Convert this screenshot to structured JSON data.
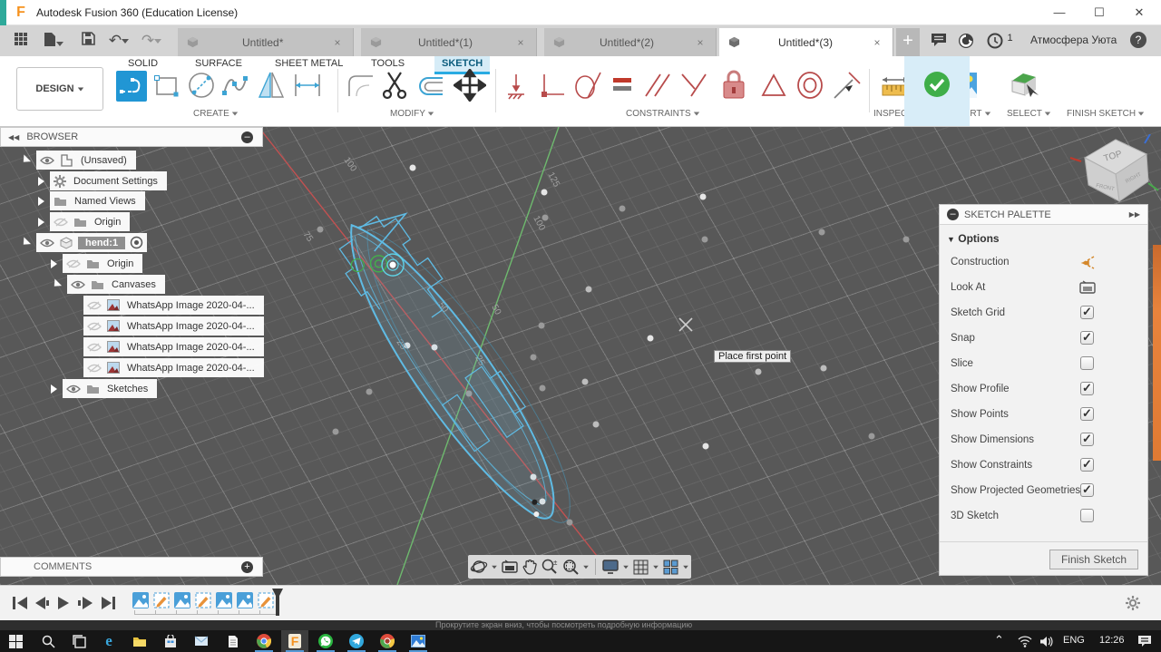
{
  "window": {
    "title": "Autodesk Fusion 360 (Education License)",
    "controls": {
      "minimize": "—",
      "maximize": "☐",
      "close": "✕"
    }
  },
  "icons": {
    "dropdown": "▼",
    "undo": "↶",
    "redo": "↷",
    "plus": "+",
    "help": "?",
    "collapse_left": "◀◀",
    "expand_right": "▶▶",
    "minus": "–",
    "chevron_up": "⌃",
    "options_arrow": "▼",
    "close": "×"
  },
  "quickbar": {
    "user": "Атмосфера Уюта",
    "notification_count": "1"
  },
  "tabs": {
    "items": [
      {
        "label": "Untitled*"
      },
      {
        "label": "Untitled*(1)"
      },
      {
        "label": "Untitled*(2)"
      },
      {
        "label": "Untitled*(3)"
      }
    ]
  },
  "ribbon": {
    "design": "DESIGN",
    "workspaces": [
      "SOLID",
      "SURFACE",
      "SHEET METAL",
      "TOOLS",
      "SKETCH"
    ],
    "active_workspace": "SKETCH",
    "groups": {
      "create": "CREATE",
      "modify": "MODIFY",
      "constraints": "CONSTRAINTS",
      "inspect": "INSPECT",
      "insert": "INSERT",
      "select": "SELECT",
      "finish": "FINISH SKETCH"
    }
  },
  "browser": {
    "title": "BROWSER",
    "items": [
      {
        "label": "(Unsaved)"
      },
      {
        "label": "Document Settings"
      },
      {
        "label": "Named Views"
      },
      {
        "label": "Origin"
      },
      {
        "label": "hend:1"
      },
      {
        "label": "Origin"
      },
      {
        "label": "Canvases"
      },
      {
        "label": "WhatsApp Image 2020-04-..."
      },
      {
        "label": "WhatsApp Image 2020-04-..."
      },
      {
        "label": "WhatsApp Image 2020-04-..."
      },
      {
        "label": "WhatsApp Image 2020-04-..."
      },
      {
        "label": "Sketches"
      }
    ]
  },
  "viewport": {
    "tooltip": "Place first point",
    "cube": {
      "top": "TOP",
      "front": "FRONT",
      "right": "RIGHT"
    },
    "grid_labels": [
      {
        "t": "75"
      },
      {
        "t": "100"
      },
      {
        "t": "125"
      },
      {
        "t": "100"
      },
      {
        "t": "50"
      },
      {
        "t": "25"
      },
      {
        "t": "25"
      },
      {
        "t": "50"
      }
    ]
  },
  "palette": {
    "title": "SKETCH PALETTE",
    "section": "Options",
    "rows": [
      {
        "label": "Construction",
        "control": "icon",
        "checked": false
      },
      {
        "label": "Look At",
        "control": "icon",
        "checked": false
      },
      {
        "label": "Sketch Grid",
        "control": "checkbox",
        "checked": true
      },
      {
        "label": "Snap",
        "control": "checkbox",
        "checked": true
      },
      {
        "label": "Slice",
        "control": "checkbox",
        "checked": false
      },
      {
        "label": "Show Profile",
        "control": "checkbox",
        "checked": true
      },
      {
        "label": "Show Points",
        "control": "checkbox",
        "checked": true
      },
      {
        "label": "Show Dimensions",
        "control": "checkbox",
        "checked": true
      },
      {
        "label": "Show Constraints",
        "control": "checkbox",
        "checked": true
      },
      {
        "label": "Show Projected Geometries",
        "control": "checkbox",
        "checked": true
      },
      {
        "label": "3D Sketch",
        "control": "checkbox",
        "checked": false
      }
    ],
    "finish_button": "Finish Sketch"
  },
  "comments": {
    "title": "COMMENTS"
  },
  "statusstrip": {
    "text": "Прокрутите экран вниз, чтобы посмотреть подробную информацию"
  },
  "taskbar": {
    "language": "ENG",
    "time": "12:26"
  },
  "colors": {
    "accent": "#29abe2",
    "sketch_line": "#5fbbe4",
    "axis_red": "#c25151",
    "axis_green": "#6eb96e",
    "constraint_red": "#b84b4b"
  }
}
